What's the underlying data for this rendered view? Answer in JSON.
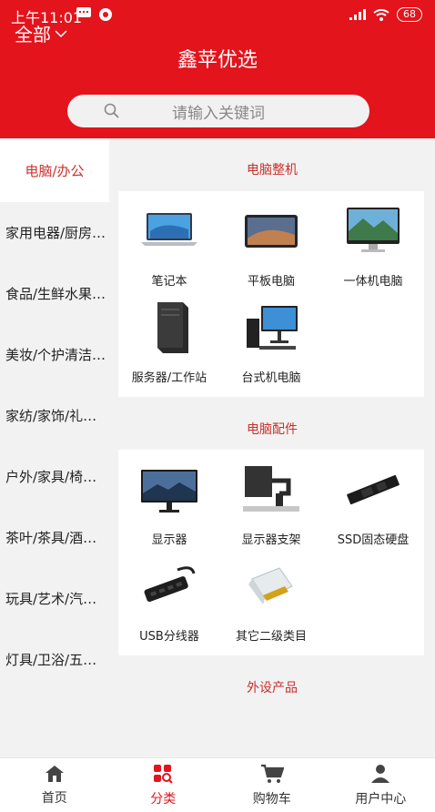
{
  "status": {
    "time": "上午11:01",
    "battery": "68"
  },
  "header": {
    "filter_label": "全部",
    "title": "鑫苹优选"
  },
  "search": {
    "placeholder": "请输入关键词"
  },
  "sidebar": {
    "items": [
      {
        "label": "电脑/办公"
      },
      {
        "label": "家用电器/厨房…"
      },
      {
        "label": "食品/生鲜水果…"
      },
      {
        "label": "美妆/个护清洁…"
      },
      {
        "label": "家纺/家饰/礼…"
      },
      {
        "label": "户外/家具/椅…"
      },
      {
        "label": "茶叶/茶具/酒…"
      },
      {
        "label": "玩具/艺术/汽…"
      },
      {
        "label": "灯具/卫浴/五…"
      }
    ]
  },
  "content": {
    "sections": [
      {
        "title": "电脑整机",
        "items": [
          {
            "label": "笔记本",
            "icon": "laptop-icon"
          },
          {
            "label": "平板电脑",
            "icon": "tablet-icon"
          },
          {
            "label": "一体机电脑",
            "icon": "all-in-one-icon"
          },
          {
            "label": "服务器/工作站",
            "icon": "server-icon"
          },
          {
            "label": "台式机电脑",
            "icon": "desktop-icon"
          }
        ]
      },
      {
        "title": "电脑配件",
        "items": [
          {
            "label": "显示器",
            "icon": "monitor-icon"
          },
          {
            "label": "显示器支架",
            "icon": "monitor-arm-icon"
          },
          {
            "label": "SSD固态硬盘",
            "icon": "ssd-icon"
          },
          {
            "label": "USB分线器",
            "icon": "usb-hub-icon"
          },
          {
            "label": "其它二级类目",
            "icon": "connector-icon"
          }
        ]
      },
      {
        "title": "外设产品",
        "items": []
      }
    ]
  },
  "tabbar": {
    "items": [
      {
        "label": "首页",
        "icon": "home-icon"
      },
      {
        "label": "分类",
        "icon": "category-icon"
      },
      {
        "label": "购物车",
        "icon": "cart-icon"
      },
      {
        "label": "用户中心",
        "icon": "user-icon"
      }
    ]
  },
  "colors": {
    "brand": "#e3141c",
    "accent_text": "#c9302c"
  }
}
